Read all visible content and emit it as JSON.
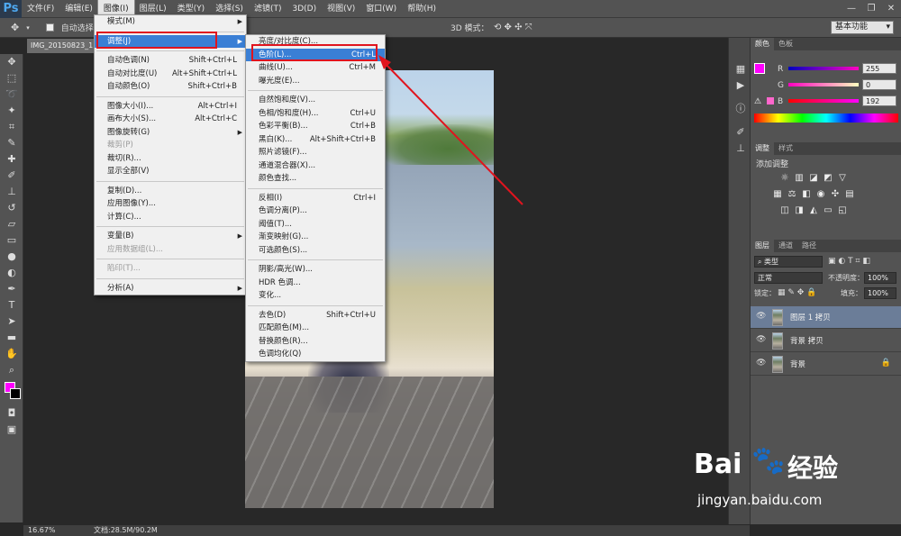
{
  "menubar": {
    "logo": "Ps",
    "items": [
      "文件(F)",
      "编辑(E)",
      "图像(I)",
      "图层(L)",
      "类型(Y)",
      "选择(S)",
      "滤镜(T)",
      "3D(D)",
      "视图(V)",
      "窗口(W)",
      "帮助(H)"
    ],
    "active_index": 2
  },
  "optbar": {
    "auto_select": "自动选择：",
    "mode_3d": "3D 模式：",
    "workspace": "基本功能"
  },
  "document_tab": "IMG_20150823_1",
  "image_menu": {
    "items": [
      {
        "label": "模式(M)",
        "shortcut": "",
        "submenu": true
      },
      {
        "sep": true
      },
      {
        "label": "调整(J)",
        "shortcut": "",
        "submenu": true,
        "highlight": true
      },
      {
        "sep": true
      },
      {
        "label": "自动色调(N)",
        "shortcut": "Shift+Ctrl+L"
      },
      {
        "label": "自动对比度(U)",
        "shortcut": "Alt+Shift+Ctrl+L"
      },
      {
        "label": "自动颜色(O)",
        "shortcut": "Shift+Ctrl+B"
      },
      {
        "sep": true
      },
      {
        "label": "图像大小(I)...",
        "shortcut": "Alt+Ctrl+I"
      },
      {
        "label": "画布大小(S)...",
        "shortcut": "Alt+Ctrl+C"
      },
      {
        "label": "图像旋转(G)",
        "shortcut": "",
        "submenu": true
      },
      {
        "label": "裁剪(P)",
        "shortcut": "",
        "disabled": true
      },
      {
        "label": "裁切(R)...",
        "shortcut": ""
      },
      {
        "label": "显示全部(V)",
        "shortcut": ""
      },
      {
        "sep": true
      },
      {
        "label": "复制(D)...",
        "shortcut": ""
      },
      {
        "label": "应用图像(Y)...",
        "shortcut": ""
      },
      {
        "label": "计算(C)...",
        "shortcut": ""
      },
      {
        "sep": true
      },
      {
        "label": "变量(B)",
        "shortcut": "",
        "submenu": true
      },
      {
        "label": "应用数据组(L)...",
        "shortcut": "",
        "disabled": true
      },
      {
        "sep": true
      },
      {
        "label": "陷印(T)...",
        "shortcut": "",
        "disabled": true
      },
      {
        "sep": true
      },
      {
        "label": "分析(A)",
        "shortcut": "",
        "submenu": true
      }
    ]
  },
  "adjust_menu": {
    "items": [
      {
        "label": "亮度/对比度(C)...",
        "shortcut": ""
      },
      {
        "label": "色阶(L)...",
        "shortcut": "Ctrl+L",
        "highlight": true
      },
      {
        "label": "曲线(U)...",
        "shortcut": "Ctrl+M"
      },
      {
        "label": "曝光度(E)...",
        "shortcut": ""
      },
      {
        "sep": true
      },
      {
        "label": "自然饱和度(V)...",
        "shortcut": ""
      },
      {
        "label": "色相/饱和度(H)...",
        "shortcut": "Ctrl+U"
      },
      {
        "label": "色彩平衡(B)...",
        "shortcut": "Ctrl+B"
      },
      {
        "label": "黑白(K)...",
        "shortcut": "Alt+Shift+Ctrl+B"
      },
      {
        "label": "照片滤镜(F)...",
        "shortcut": ""
      },
      {
        "label": "通道混合器(X)...",
        "shortcut": ""
      },
      {
        "label": "颜色查找...",
        "shortcut": ""
      },
      {
        "sep": true
      },
      {
        "label": "反相(I)",
        "shortcut": "Ctrl+I"
      },
      {
        "label": "色调分离(P)...",
        "shortcut": ""
      },
      {
        "label": "阈值(T)...",
        "shortcut": ""
      },
      {
        "label": "渐变映射(G)...",
        "shortcut": ""
      },
      {
        "label": "可选颜色(S)...",
        "shortcut": ""
      },
      {
        "sep": true
      },
      {
        "label": "阴影/高光(W)...",
        "shortcut": ""
      },
      {
        "label": "HDR 色调...",
        "shortcut": ""
      },
      {
        "label": "变化...",
        "shortcut": ""
      },
      {
        "sep": true
      },
      {
        "label": "去色(D)",
        "shortcut": "Shift+Ctrl+U"
      },
      {
        "label": "匹配颜色(M)...",
        "shortcut": ""
      },
      {
        "label": "替换颜色(R)...",
        "shortcut": ""
      },
      {
        "label": "色调均化(Q)",
        "shortcut": ""
      }
    ]
  },
  "color_panel": {
    "tabs": [
      "颜色",
      "色板"
    ],
    "r_label": "R",
    "r_value": "255",
    "g_label": "G",
    "g_value": "0",
    "b_label": "B",
    "b_value": "192",
    "fg_color": "#ff00c0"
  },
  "adjust_panel": {
    "tabs": [
      "调整",
      "样式"
    ],
    "title": "添加调整"
  },
  "layers_panel": {
    "tabs": [
      "图层",
      "通道",
      "路径"
    ],
    "filter": "类型",
    "blend_mode": "正常",
    "opacity_label": "不透明度：",
    "opacity": "100%",
    "lock_label": "锁定：",
    "fill_label": "填充：",
    "fill": "100%",
    "layers": [
      {
        "name": "图层 1 拷贝",
        "selected": true,
        "locked": false
      },
      {
        "name": "背景 拷贝",
        "selected": false,
        "locked": false
      },
      {
        "name": "背景",
        "selected": false,
        "locked": true
      }
    ]
  },
  "status": {
    "zoom": "16.67%",
    "doc": "文档:28.5M/90.2M"
  },
  "watermark": {
    "brand": "Bai",
    "cn": "经验",
    "url": "jingyan.baidu.com"
  },
  "colors": {
    "highlight": "#3a7fd5",
    "annotation_red": "#e0141e",
    "foreground": "#ff00ff"
  }
}
